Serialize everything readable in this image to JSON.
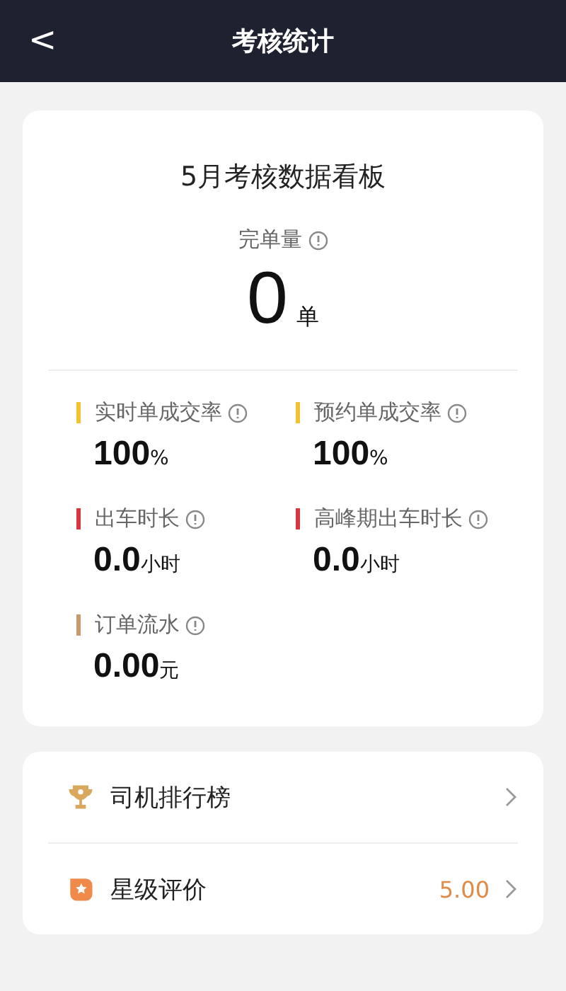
{
  "header": {
    "back": "<",
    "title": "考核统计"
  },
  "board": {
    "title": "5月考核数据看板",
    "total_label": "完单量",
    "total_value": "0",
    "total_unit": "单",
    "metrics": [
      {
        "label": "实时单成交率",
        "value": "100",
        "unit": "%",
        "color": "#f2c230"
      },
      {
        "label": "预约单成交率",
        "value": "100",
        "unit": "%",
        "color": "#f2c230"
      },
      {
        "label": "出车时长",
        "value": "0.0",
        "unit": "小时",
        "color": "#d9363e"
      },
      {
        "label": "高峰期出车时长",
        "value": "0.0",
        "unit": "小时",
        "color": "#d9363e"
      },
      {
        "label": "订单流水",
        "value": "0.00",
        "unit": "元",
        "color": "#c99a6a"
      }
    ]
  },
  "menu": [
    {
      "kind": "ranking",
      "label": "司机排行榜"
    },
    {
      "kind": "rating",
      "label": "星级评价",
      "value": "5.00"
    }
  ]
}
